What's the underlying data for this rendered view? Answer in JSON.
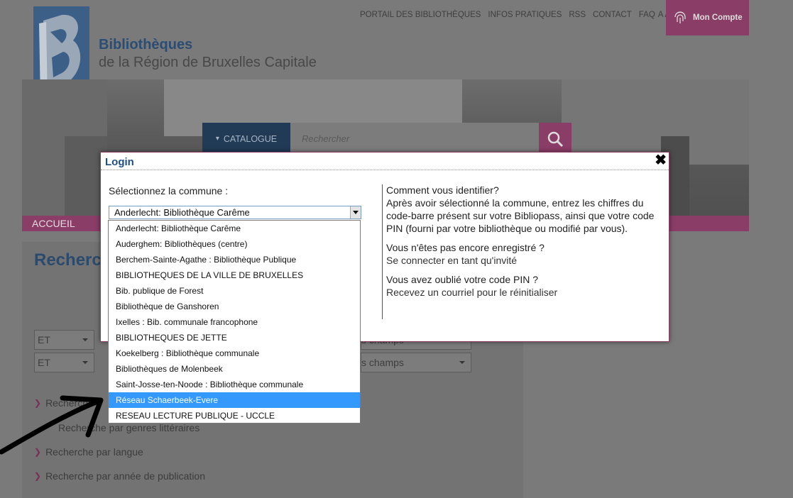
{
  "header": {
    "title": "Bibliothèques",
    "subtitle": "de la Région de Bruxelles Capitale",
    "topnav": [
      "PORTAIL DES BIBLIOTHÈQUES",
      "INFOS PRATIQUES",
      "RSS",
      "CONTACT",
      "FAQ"
    ],
    "font_sizes": "A A A",
    "account_label": "Mon Compte"
  },
  "search": {
    "catalog_label": "CATALOGUE",
    "placeholder": "Rechercher"
  },
  "mainnav": {
    "home": "ACCUEIL"
  },
  "content": {
    "title_partial": "Recherc",
    "operators": [
      "ET",
      "ET"
    ],
    "field_selects": [
      "s champs",
      "s champs"
    ],
    "links": [
      "Recherche p",
      "Recherche par genres littéraires",
      "Recherche par langue",
      "Recherche par année de publication"
    ]
  },
  "modal": {
    "title": "Login",
    "close": "✖",
    "commune_label": "Sélectionnez la commune :",
    "selected_value": "Anderlecht: Bibliothèque Carême",
    "help_title": "Comment vous identifier?",
    "help_text": "Après avoir sélectionné la commune, entrez les chiffres du code-barre présent sur votre Bibliopass, ainsi que votre code PIN (fourni par votre bibliothèque ou modifié par vous).",
    "not_registered": "Vous n'êtes pas encore enregistré ?",
    "guest_link": "Se connecter en tant qu'invité",
    "forgot_pin": "Vous avez oublié votre code PIN ?",
    "reset_link": "Recevez un courriel pour le réinitialiser"
  },
  "dropdown": {
    "options": [
      "Anderlecht: Bibliothèque Carême",
      "Auderghem: Bibliothèques (centre)",
      "Berchem-Sainte-Agathe : Bibliothèque Publique",
      "BIBLIOTHEQUES DE LA VILLE DE BRUXELLES",
      "Bib. publique de Forest",
      "Bibliothèque de Ganshoren",
      "Ixelles : Bib. communale francophone",
      "BIBLIOTHEQUES DE JETTE",
      "Koekelberg : Bibliothèque communale",
      "Bibliothèques de Molenbeek",
      "Saint-Josse-ten-Noode : Bibliothèque communale",
      "Réseau Schaerbeek-Evere",
      "RESEAU LECTURE PUBLIQUE - UCCLE"
    ],
    "highlighted_index": 11
  },
  "colors": {
    "accent": "#8a3d66",
    "link_blue": "#1e4f86",
    "highlight": "#3399ff"
  }
}
